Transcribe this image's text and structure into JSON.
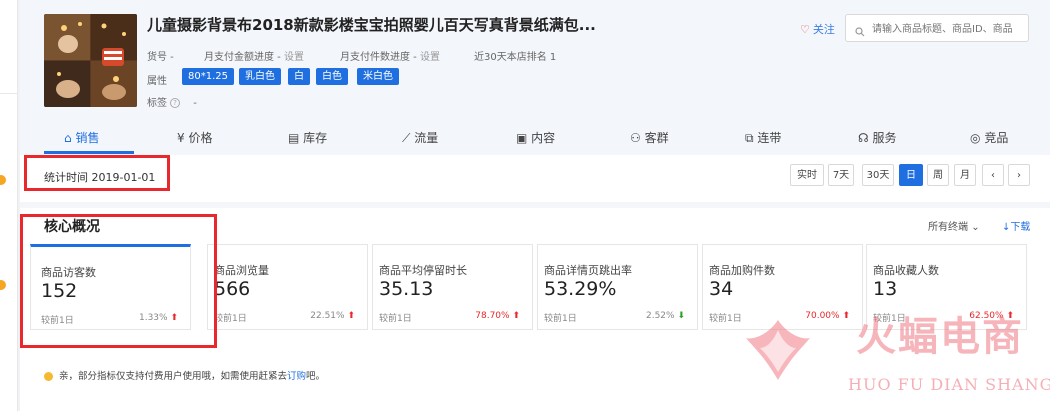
{
  "product": {
    "title": "儿童摄影背景布2018新款影楼宝宝拍照婴儿百天写真背景纸满包...",
    "favorite_label": "关注",
    "meta": [
      {
        "label": "货号 -"
      },
      {
        "label": "月支付金额进度 -",
        "link": "设置"
      },
      {
        "label": "月支付件数进度 -",
        "link": "设置"
      },
      {
        "label": "近30天本店排名 1"
      }
    ],
    "attr_label": "属性",
    "tags": [
      "80*1.25",
      "乳白色",
      "白",
      "白色",
      "米白色"
    ],
    "label_row_label": "标签",
    "label_row_value": "-"
  },
  "search": {
    "placeholder": "请输入商品标题、商品ID、商品"
  },
  "tabs": [
    {
      "label": "销售",
      "icon": "home-icon"
    },
    {
      "label": "价格",
      "icon": "price-icon"
    },
    {
      "label": "库存",
      "icon": "inventory-icon"
    },
    {
      "label": "流量",
      "icon": "traffic-icon"
    },
    {
      "label": "内容",
      "icon": "content-icon"
    },
    {
      "label": "客群",
      "icon": "customer-icon"
    },
    {
      "label": "连带",
      "icon": "link-icon"
    },
    {
      "label": "服务",
      "icon": "service-icon"
    },
    {
      "label": "竞品",
      "icon": "competitor-icon"
    }
  ],
  "date_bar": {
    "stat_time": "统计时间 2019-01-01",
    "buttons": [
      "实时",
      "7天",
      "30天",
      "日",
      "周",
      "月",
      "‹",
      "›"
    ],
    "active": "日"
  },
  "overview": {
    "title": "核心概况",
    "terminal": "所有终端",
    "download": "下载",
    "metrics": [
      {
        "label": "商品访客数",
        "value": "152",
        "compare": "较前1日",
        "pct": "1.33%",
        "dir": "up"
      },
      {
        "label": "商品浏览量",
        "value": "566",
        "compare": "较前1日",
        "pct": "22.51%",
        "dir": "up"
      },
      {
        "label": "商品平均停留时长",
        "value": "35.13",
        "compare": "较前1日",
        "pct": "78.70%",
        "dir": "up"
      },
      {
        "label": "商品详情页跳出率",
        "value": "53.29%",
        "compare": "较前1日",
        "pct": "2.52%",
        "dir": "down"
      },
      {
        "label": "商品加购件数",
        "value": "34",
        "compare": "较前1日",
        "pct": "70.00%",
        "dir": "up"
      },
      {
        "label": "商品收藏人数",
        "value": "13",
        "compare": "较前1日",
        "pct": "62.50%",
        "dir": "up"
      }
    ],
    "notice_text": "亲，部分指标仅支持付费用户使用哦，如需使用赶紧去",
    "notice_link": "订购",
    "notice_tail": "吧。"
  },
  "watermark": {
    "text": "火蝠电商",
    "sub": "HUO FU DIAN SHANG"
  },
  "colors": {
    "accent": "#1f6fe0",
    "up": "#e8282c",
    "down": "#2ca02c",
    "highlight": "#e8282c"
  }
}
